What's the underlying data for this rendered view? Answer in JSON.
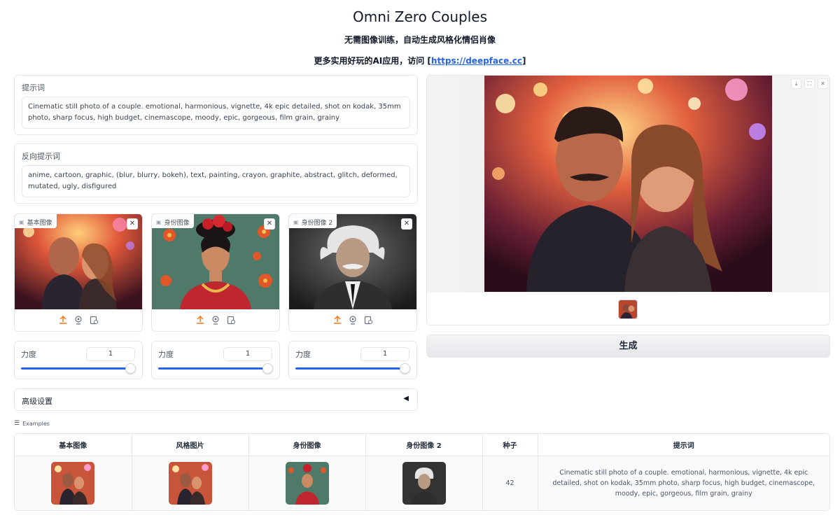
{
  "header": {
    "title": "Omni Zero Couples",
    "subtitle": "无需图像训练，自动生成风格化情侣肖像",
    "subtitle2_prefix": "更多实用好玩的AI应用，访问 [",
    "subtitle2_link": "https://deepface.cc",
    "subtitle2_suffix": "]"
  },
  "prompt": {
    "label": "提示词",
    "value": "Cinematic still photo of a couple. emotional, harmonious, vignette, 4k epic detailed, shot on kodak, 35mm photo, sharp focus, high budget, cinemascope, moody, epic, gorgeous, film grain, grainy"
  },
  "negative_prompt": {
    "label": "反向提示词",
    "value": "anime, cartoon, graphic, (blur, blurry, bokeh), text, painting, crayon, graphite, abstract, glitch, deformed, mutated, ugly, disfigured"
  },
  "image_inputs": [
    {
      "label": "基本图像",
      "image": "couple-photo"
    },
    {
      "label": "身份图像",
      "image": "frida-portrait"
    },
    {
      "label": "身份图像 2",
      "image": "einstein-portrait"
    }
  ],
  "sliders": [
    {
      "label": "力度",
      "value": "1",
      "level": 1.0
    },
    {
      "label": "力度",
      "value": "1",
      "level": 1.0
    },
    {
      "label": "力度",
      "value": "1",
      "level": 1.0
    }
  ],
  "advanced": {
    "label": "高级设置",
    "arrow": "◀"
  },
  "generate_button": "生成",
  "examples": {
    "label": "Examples",
    "headers": [
      "基本图像",
      "风格图片",
      "身份图像",
      "身份图像 2",
      "种子",
      "提示词"
    ],
    "row": {
      "seed": "42",
      "prompt": "Cinematic still photo of a couple. emotional, harmonious, vignette, 4k epic detailed, shot on kodak, 35mm photo, sharp focus, high budget, cinemascope, moody, epic, gorgeous, film grain, grainy"
    }
  },
  "colors": {
    "accent": "#2563eb",
    "upload_icon": "#f97316",
    "border": "#e5e7eb"
  }
}
